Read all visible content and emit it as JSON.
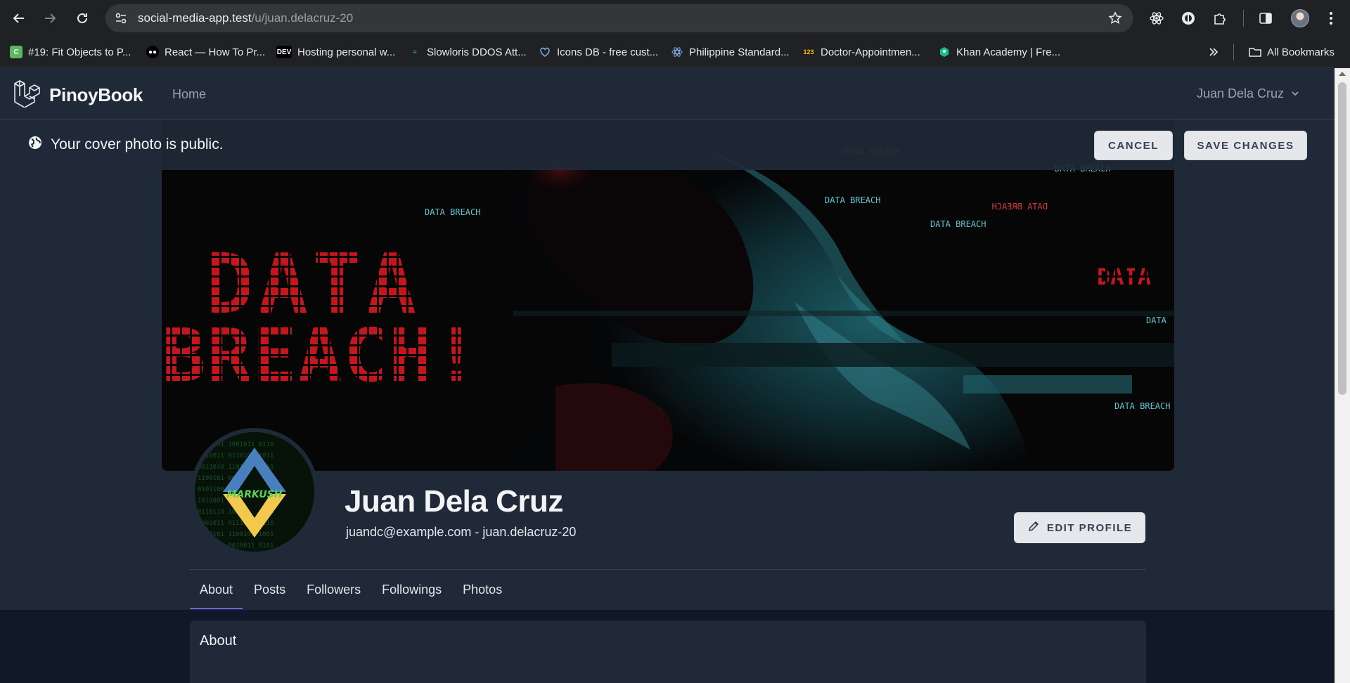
{
  "browser": {
    "url_host": "social-media-app.test",
    "url_path": "/u/juan.delacruz-20",
    "bookmarks": [
      {
        "label": "#19: Fit Objects to P...",
        "icon": "c-favicon"
      },
      {
        "label": "React — How To Pr...",
        "icon": "medium-favicon"
      },
      {
        "label": "Hosting personal w...",
        "icon": "dev-favicon"
      },
      {
        "label": "Slowloris DDOS Att...",
        "icon": "gg-favicon"
      },
      {
        "label": "Icons DB - free cust...",
        "icon": "heart-favicon"
      },
      {
        "label": "Philippine Standard...",
        "icon": "react-favicon"
      },
      {
        "label": "Doctor-Appointmen...",
        "icon": "123-favicon"
      },
      {
        "label": "Khan Academy | Fre...",
        "icon": "khan-favicon"
      }
    ],
    "all_bookmarks_label": "All Bookmarks"
  },
  "app": {
    "brand": "PinoyBook",
    "nav_home": "Home",
    "user_name": "Juan Dela Cruz"
  },
  "notice": {
    "text": "Your cover photo is public.",
    "cancel_label": "CANCEL",
    "save_label": "SAVE CHANGES"
  },
  "cover": {
    "big_text_1": "DATA",
    "big_text_2": "BREACH!",
    "small_label": "DATA BREACH",
    "mirrored_label": "DATA BREACH",
    "side_label": "DATA"
  },
  "avatar": {
    "logo_text": "MARKUSH"
  },
  "profile": {
    "name": "Juan Dela Cruz",
    "subline": "juandc@example.com - juan.delacruz-20",
    "edit_label": "EDIT PROFILE"
  },
  "tabs": [
    {
      "label": "About",
      "active": true
    },
    {
      "label": "Posts",
      "active": false
    },
    {
      "label": "Followers",
      "active": false
    },
    {
      "label": "Followings",
      "active": false
    },
    {
      "label": "Photos",
      "active": false
    }
  ],
  "about": {
    "title": "About"
  },
  "colors": {
    "accent": "#6366f1",
    "app_bg": "#1f2937",
    "page_bg": "#111827"
  }
}
